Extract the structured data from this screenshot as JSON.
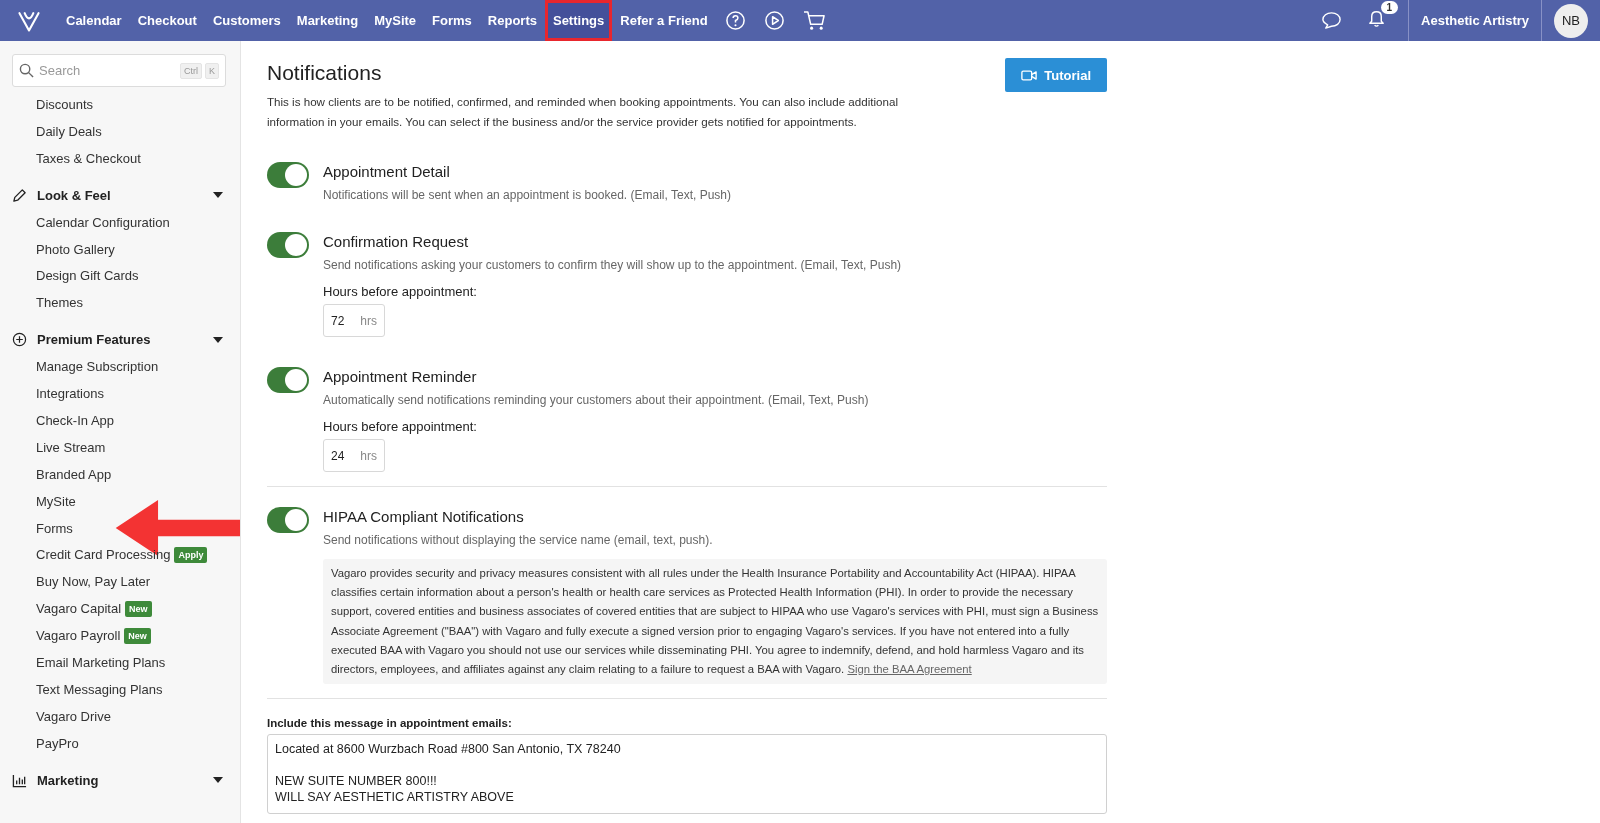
{
  "topbar": {
    "nav": [
      {
        "label": "Calendar",
        "selected": false,
        "highlighted": false
      },
      {
        "label": "Checkout",
        "selected": false,
        "highlighted": false
      },
      {
        "label": "Customers",
        "selected": false,
        "highlighted": false
      },
      {
        "label": "Marketing",
        "selected": false,
        "highlighted": false
      },
      {
        "label": "MySite",
        "selected": false,
        "highlighted": false
      },
      {
        "label": "Forms",
        "selected": false,
        "highlighted": false
      },
      {
        "label": "Reports",
        "selected": false,
        "highlighted": false
      },
      {
        "label": "Settings",
        "selected": true,
        "highlighted": true
      },
      {
        "label": "Refer a Friend",
        "selected": false,
        "highlighted": false
      }
    ],
    "notification_count": "1",
    "business": "Aesthetic Artistry",
    "avatar": "NB"
  },
  "sidebar": {
    "search": {
      "placeholder": "Search",
      "keys": [
        "Ctrl",
        "K"
      ]
    },
    "groups": [
      {
        "items": [
          {
            "label": "Discounts"
          },
          {
            "label": "Daily Deals"
          },
          {
            "label": "Taxes & Checkout"
          }
        ]
      },
      {
        "title": "Look & Feel",
        "kind": "pencil",
        "expanded": true,
        "items": [
          {
            "label": "Calendar Configuration"
          },
          {
            "label": "Photo Gallery"
          },
          {
            "label": "Design Gift Cards"
          },
          {
            "label": "Themes"
          }
        ]
      },
      {
        "title": "Premium Features",
        "kind": "plus",
        "expanded": true,
        "items": [
          {
            "label": "Manage Subscription"
          },
          {
            "label": "Integrations"
          },
          {
            "label": "Check-In App"
          },
          {
            "label": "Live Stream"
          },
          {
            "label": "Branded App"
          },
          {
            "label": "MySite"
          },
          {
            "label": "Forms",
            "pointed": true
          },
          {
            "label": "Credit Card Processing",
            "badge": "Apply"
          },
          {
            "label": "Buy Now, Pay Later"
          },
          {
            "label": "Vagaro Capital",
            "badge": "New"
          },
          {
            "label": "Vagaro Payroll",
            "badge": "New"
          },
          {
            "label": "Email Marketing Plans"
          },
          {
            "label": "Text Messaging Plans"
          },
          {
            "label": "Vagaro Drive"
          },
          {
            "label": "PayPro"
          }
        ]
      },
      {
        "title": "Marketing",
        "kind": "chart",
        "expanded": true
      }
    ]
  },
  "page": {
    "title": "Notifications",
    "tutorial_button": "Tutorial",
    "description": "This is how clients are to be notified, confirmed, and reminded when booking appointments. You can also include additional information in your emails. You can select if the business and/or the service provider gets notified for appointments.",
    "settings": [
      {
        "title": "Appointment Detail",
        "on": true,
        "description": "Notifications will be sent when an appointment is booked. (Email, Text, Push)"
      },
      {
        "title": "Confirmation Request",
        "on": true,
        "description": "Send notifications asking your customers to confirm they will show up to the appointment. (Email, Text, Push)",
        "hours": {
          "label": "Hours before appointment:",
          "value": "72",
          "unit": "hrs"
        }
      },
      {
        "title": "Appointment Reminder",
        "on": true,
        "description": "Automatically send notifications reminding your customers about their appointment. (Email, Text, Push)",
        "hours": {
          "label": "Hours before appointment:",
          "value": "24",
          "unit": "hrs"
        }
      },
      {
        "title": "HIPAA Compliant Notifications",
        "on": true,
        "description": "Send notifications without displaying the service name (email, text, push).",
        "notice": "Vagaro provides security and privacy measures consistent with all rules under the Health Insurance Portability and Accountability Act (HIPAA). HIPAA classifies certain information about a person's health or health care services as Protected Health Information (PHI). In order to provide the necessary support, covered entities and business associates of covered entities that are subject to HIPAA who use Vagaro's services with PHI, must sign a Business Associate Agreement (\"BAA\") with Vagaro and fully execute a signed version prior to engaging Vagaro's services. If you have not entered into a fully executed BAA with Vagaro you should not use our services while disseminating PHI. You agree to indemnify, defend, and hold harmless Vagaro and its directors, employees, and affiliates against any claim relating to a failure to request a BAA with Vagaro.",
        "notice_link": "Sign the BAA Agreement"
      }
    ],
    "message": {
      "label": "Include this message in appointment emails:",
      "paragraphs": [
        [
          "Located at 8600 Wurzbach Road #800 San Antonio, TX 78240"
        ],
        [
          "NEW SUITE NUMBER 800!!!",
          "WILL SAY AESTHETIC ARTISTRY ABOVE"
        ]
      ]
    }
  }
}
